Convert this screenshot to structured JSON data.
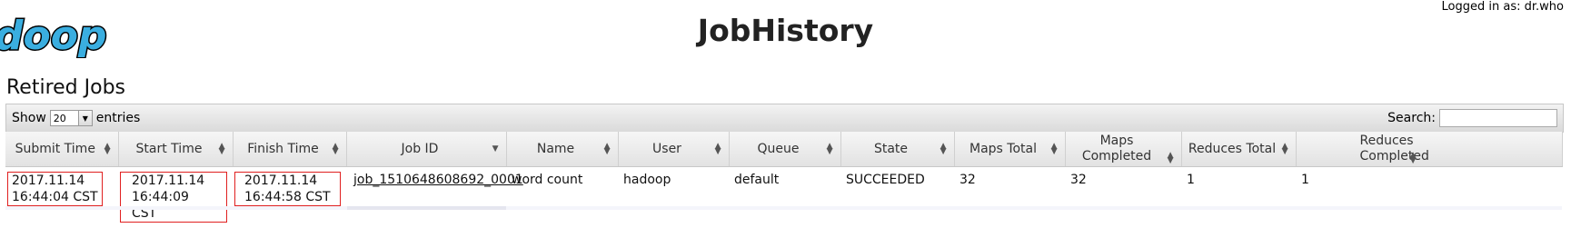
{
  "header": {
    "logo_text": "doop",
    "title": "JobHistory",
    "logged_in": "Logged in as: dr.who"
  },
  "section": {
    "title": "Retired Jobs"
  },
  "toolbar": {
    "show_label": "Show",
    "entries_value": "20",
    "entries_label": "entries",
    "search_label": "Search:"
  },
  "table": {
    "columns": [
      "Submit Time",
      "Start Time",
      "Finish Time",
      "Job ID",
      "Name",
      "User",
      "Queue",
      "State",
      "Maps Total",
      "Maps Completed",
      "Reduces Total",
      "Reduces Completed"
    ],
    "rows": [
      {
        "submit_date": "2017.11.14",
        "submit_time": "16:44:04 CST",
        "start_date": "2017.11.14",
        "start_time": "16:44:09 CST",
        "finish_date": "2017.11.14",
        "finish_time": "16:44:58 CST",
        "job_id": "job_1510648608692_0001",
        "name": "word count",
        "user": "hadoop",
        "queue": "default",
        "state": "SUCCEEDED",
        "maps_total": "32",
        "maps_completed": "32",
        "reduces_total": "1",
        "reduces_completed": "1"
      }
    ]
  },
  "colors": {
    "highlight_box": "#e02020",
    "logo_fill": "#3aaee0",
    "header_gradient_top": "#f6f6f6",
    "header_gradient_bottom": "#e2e2e2"
  },
  "icons": {
    "sort": "sort-arrows-icon",
    "dropdown": "chevron-down-icon"
  }
}
